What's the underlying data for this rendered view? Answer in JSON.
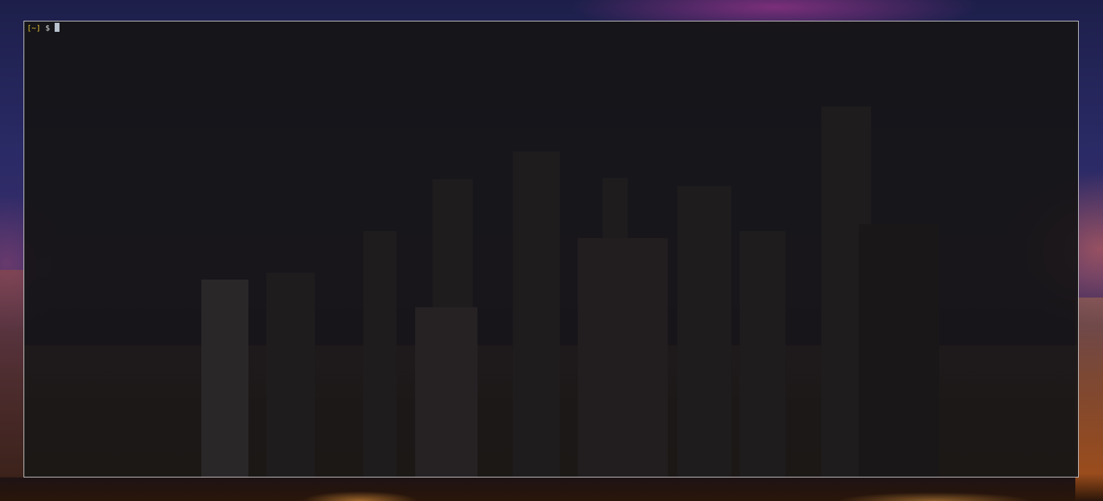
{
  "terminal": {
    "prompt_dir": "[~]",
    "prompt_symbol": "$",
    "command_text": ""
  },
  "colors": {
    "prompt_dir": "#e2c23a",
    "terminal_border": "#c9c9c9",
    "cursor": "#b9c2cf"
  }
}
